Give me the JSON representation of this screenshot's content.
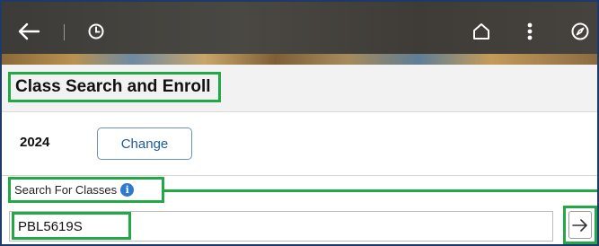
{
  "header": {
    "icons": [
      "back-arrow-icon",
      "history-clock-icon",
      "home-icon",
      "actions-menu-icon",
      "navbar-compass-icon"
    ],
    "bar_color": "#3f3d39"
  },
  "page": {
    "title": "Class Search and Enroll"
  },
  "term": {
    "value": "2024",
    "change_label": "Change"
  },
  "search": {
    "label": "Search For Classes",
    "info_glyph": "i",
    "value": "PBL5619S",
    "go_glyph": "→"
  },
  "colors": {
    "highlight": "#22a845",
    "link": "#1b5aa6",
    "info": "#2f78d1"
  }
}
